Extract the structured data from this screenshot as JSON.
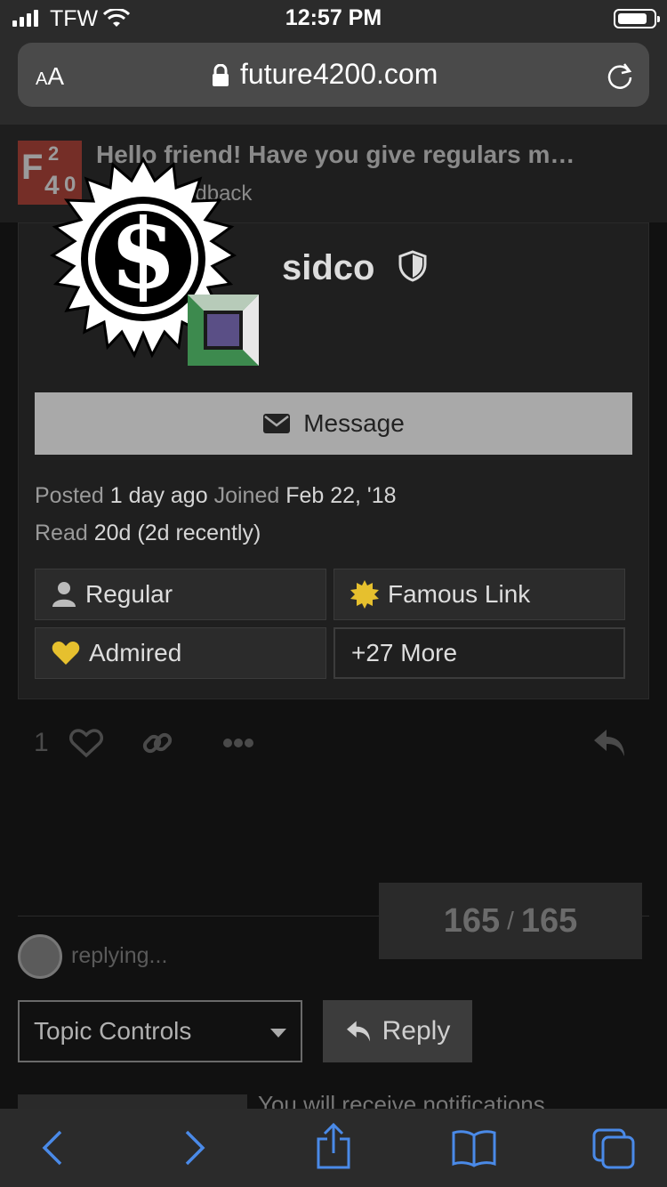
{
  "status_bar": {
    "carrier": "TFW",
    "time": "12:57 PM"
  },
  "browser": {
    "text_size_label": "AA",
    "url": "future4200.com"
  },
  "header": {
    "logo_text": "F4 2 0",
    "topic_title": "Hello friend! Have you give regulars m…",
    "category": "Site Feedback"
  },
  "user_card": {
    "username": "sidco",
    "message_label": "Message",
    "posted_label": "Posted",
    "posted_value": "1 day ago",
    "joined_label": "Joined",
    "joined_value": "Feb 22, '18",
    "read_label": "Read",
    "read_value": "20d (2d recently)",
    "badges": [
      {
        "label": "Regular",
        "icon": "user-icon"
      },
      {
        "label": "Famous Link",
        "icon": "sun-badge-icon"
      },
      {
        "label": "Admired",
        "icon": "heart-icon"
      },
      {
        "label": "+27 More",
        "icon": ""
      }
    ]
  },
  "post_actions": {
    "like_count": "1"
  },
  "progress": {
    "current": "165",
    "separator": "/",
    "total": "165"
  },
  "composer": {
    "replying_text": "replying...",
    "topic_controls_label": "Topic Controls",
    "reply_label": "Reply",
    "notification_text": "You will receive notifications"
  },
  "colors": {
    "badge_gold": "#e6c02e",
    "flair_green": "#3d8a4e",
    "background": "#111111"
  }
}
